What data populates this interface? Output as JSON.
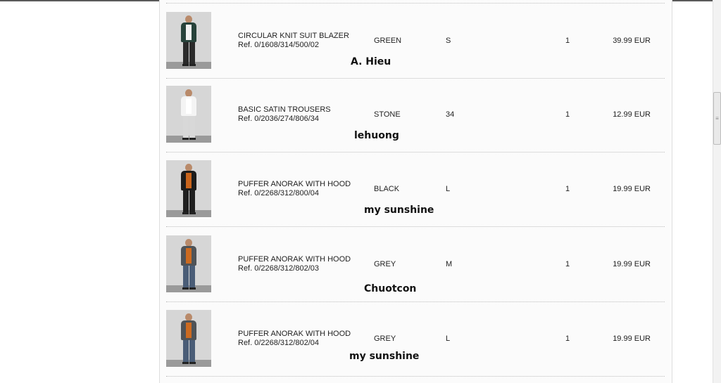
{
  "rows": [
    {
      "name": "CIRCULAR KNIT SUIT BLAZER",
      "ref": "Ref. 0/1608/314/500/02",
      "color": "GREEN",
      "size": "S",
      "qty": "1",
      "price": "39.99 EUR",
      "signature": "A. Hieu",
      "thumb_icon": "person-in-blazer-icon",
      "outfit": {
        "top": "#27423a",
        "inner": "#f2f2f2",
        "legs": "#2b2b2b"
      }
    },
    {
      "name": "BASIC SATIN TROUSERS",
      "ref": "Ref. 0/2036/274/806/34",
      "color": "STONE",
      "size": "34",
      "qty": "1",
      "price": "12.99 EUR",
      "signature": "lehuong",
      "thumb_icon": "person-in-trousers-icon",
      "outfit": {
        "top": "#f4f4f4",
        "inner": "#ffffff",
        "legs": "#d8d8d8"
      }
    },
    {
      "name": "PUFFER ANORAK WITH HOOD",
      "ref": "Ref. 0/2268/312/800/04",
      "color": "BLACK",
      "size": "L",
      "qty": "1",
      "price": "19.99 EUR",
      "signature": "my sunshine",
      "thumb_icon": "person-in-anorak-icon",
      "outfit": {
        "top": "#1c1c1c",
        "inner": "#c8641c",
        "legs": "#1f1f1f"
      }
    },
    {
      "name": "PUFFER ANORAK WITH HOOD",
      "ref": "Ref. 0/2268/312/802/03",
      "color": "GREY",
      "size": "M",
      "qty": "1",
      "price": "19.99 EUR",
      "signature": "Chuotcon",
      "thumb_icon": "person-in-anorak-icon",
      "outfit": {
        "top": "#4f5357",
        "inner": "#cc6a20",
        "legs": "#4a5d77"
      }
    },
    {
      "name": "PUFFER ANORAK WITH HOOD",
      "ref": "Ref. 0/2268/312/802/04",
      "color": "GREY",
      "size": "L",
      "qty": "1",
      "price": "19.99 EUR",
      "signature": "my sunshine",
      "thumb_icon": "person-in-anorak-icon",
      "outfit": {
        "top": "#4f5357",
        "inner": "#cc6a20",
        "legs": "#4a5d77"
      }
    }
  ],
  "scrollbar": {
    "grip": "≡"
  },
  "colors": {
    "text": "#222222",
    "divider": "#bdbdbd",
    "panel": "#fbfbfb"
  }
}
